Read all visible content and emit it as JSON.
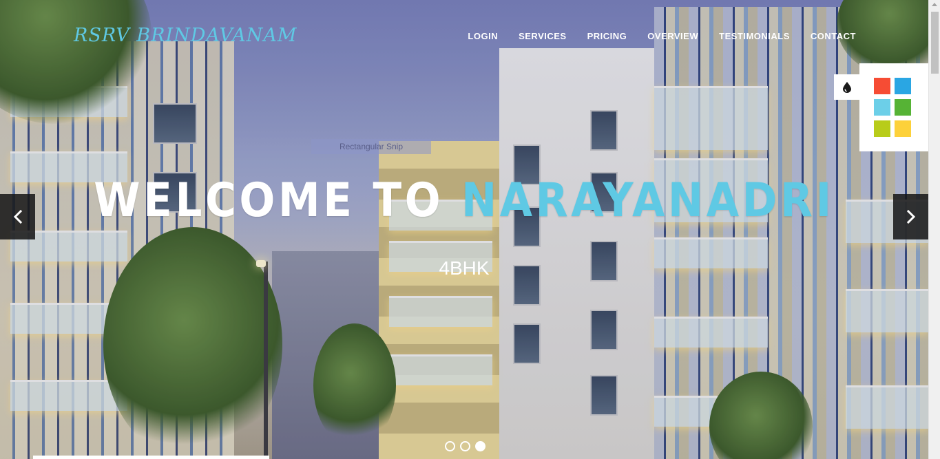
{
  "brand": {
    "name": "RSRV BRINDAVANAM"
  },
  "nav": {
    "items": [
      {
        "label": "LOGIN"
      },
      {
        "label": "SERVICES"
      },
      {
        "label": "PRICING"
      },
      {
        "label": "OVERVIEW"
      },
      {
        "label": "TESTIMONIALS"
      },
      {
        "label": "CONTACT"
      }
    ]
  },
  "hero": {
    "headline_prefix": "WELCOME TO",
    "headline_accent": "NARAYANADRI",
    "subtitle": "4BHK",
    "accent_color": "#5fc9e4"
  },
  "snip_tooltip": {
    "label": "Rectangular Snip"
  },
  "color_switcher": {
    "toggle_icon": "drop-icon",
    "swatches": [
      {
        "color": "#f64c34"
      },
      {
        "color": "#2aa6e3"
      },
      {
        "color": "#6ccfe8"
      },
      {
        "color": "#56b335"
      },
      {
        "color": "#b8cc1a"
      },
      {
        "color": "#fdd13a"
      }
    ]
  },
  "carousel": {
    "prev_icon": "chevron-left-icon",
    "next_icon": "chevron-right-icon",
    "slides_total": 3,
    "active_slide": 3
  }
}
